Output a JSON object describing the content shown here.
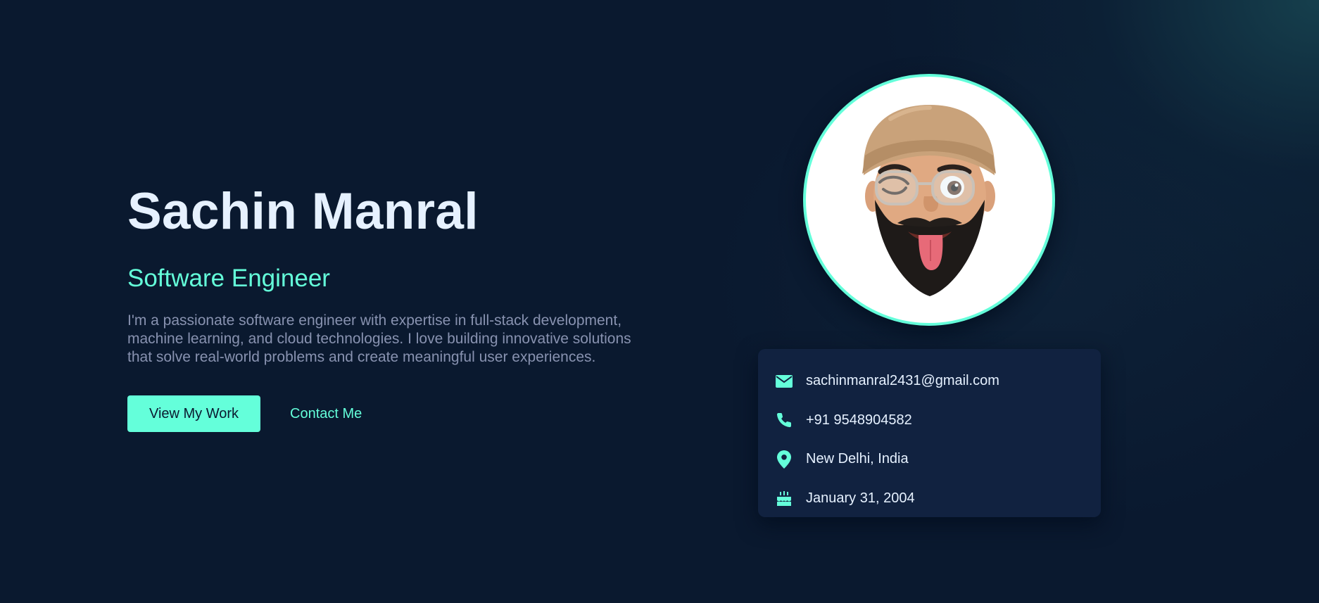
{
  "hero": {
    "name": "Sachin Manral",
    "role": "Software Engineer",
    "bio": "I'm a passionate software engineer with expertise in full-stack development, machine learning, and cloud technologies. I love building innovative solutions that solve real-world problems and create meaningful user experiences.",
    "primary_button": "View My Work",
    "secondary_button": "Contact Me"
  },
  "profile": {
    "avatar": "memoji-avatar"
  },
  "contact": {
    "items": [
      {
        "icon": "envelope-icon",
        "text": "sachinmanral2431@gmail.com"
      },
      {
        "icon": "phone-icon",
        "text": "+91 9548904582"
      },
      {
        "icon": "map-pin-icon",
        "text": "New Delhi, India"
      },
      {
        "icon": "birthday-cake-icon",
        "text": "January 31, 2004"
      }
    ]
  },
  "colors": {
    "background": "#0a192f",
    "accent": "#64ffda",
    "heading": "#e6f1ff",
    "body_text": "#8892b0",
    "card": "#112240"
  }
}
